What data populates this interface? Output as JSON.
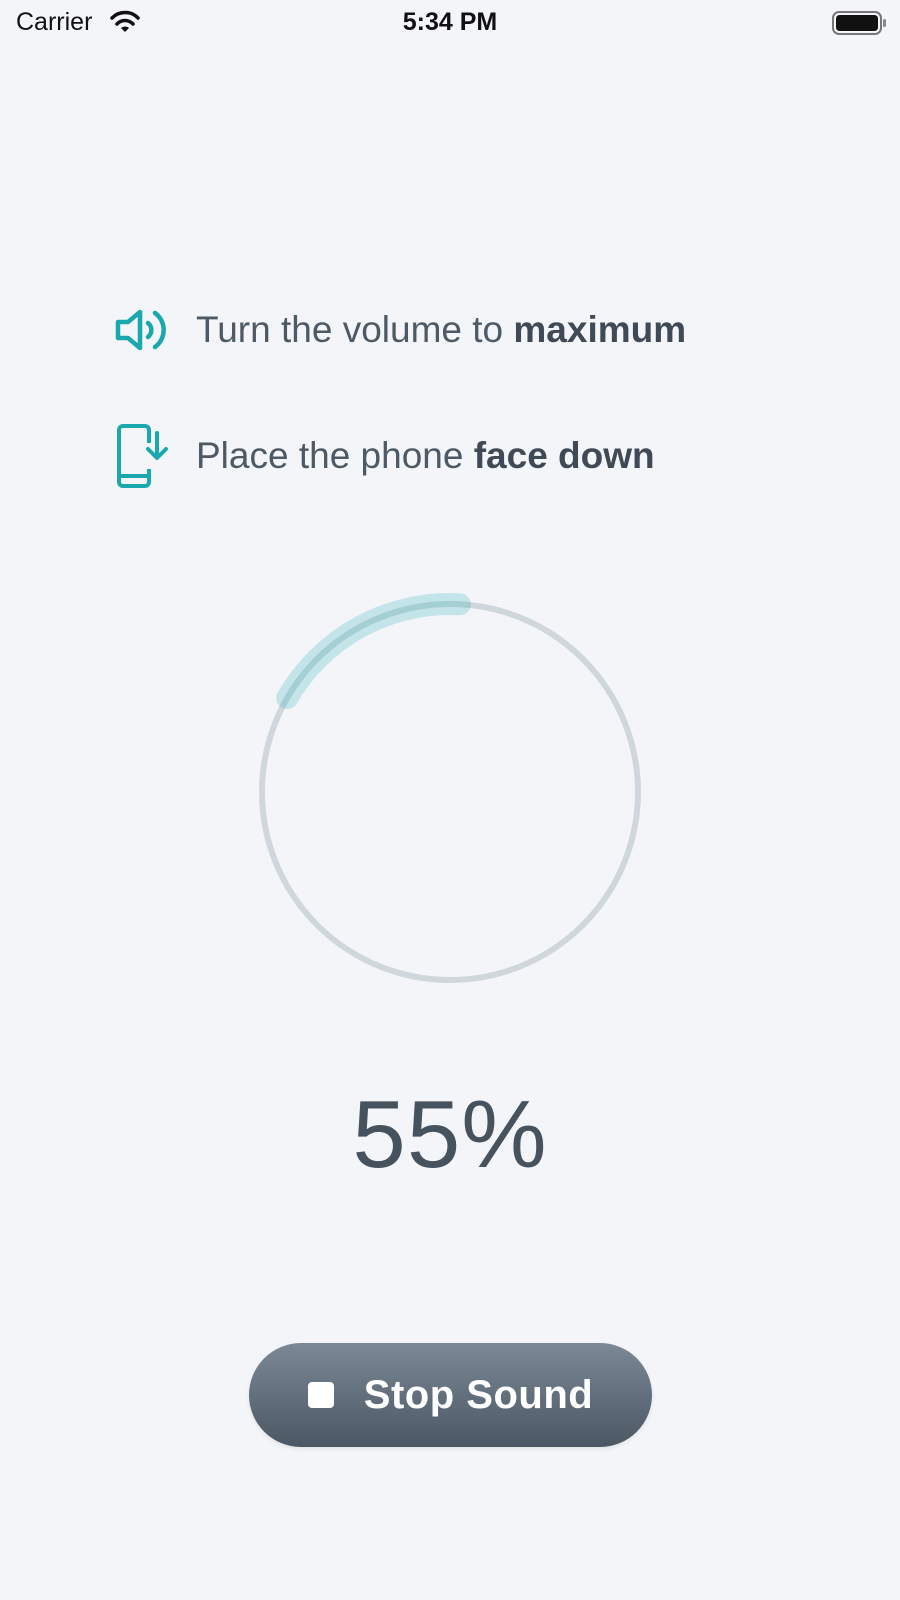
{
  "status_bar": {
    "carrier": "Carrier",
    "time": "5:34 PM",
    "wifi_icon": "wifi-icon",
    "battery_icon": "battery-icon"
  },
  "instructions": [
    {
      "icon": "speaker-volume-icon",
      "text_prefix": "Turn the volume to ",
      "text_bold": "maximum"
    },
    {
      "icon": "phone-face-down-icon",
      "text_prefix": "Place the phone ",
      "text_bold": "face down"
    }
  ],
  "progress": {
    "value": 0.55,
    "label": "55%",
    "accent_color": "#1aa8ae",
    "track_color": "#cfd7dd"
  },
  "stop_button": {
    "icon": "stop-icon",
    "label": "Stop Sound"
  }
}
